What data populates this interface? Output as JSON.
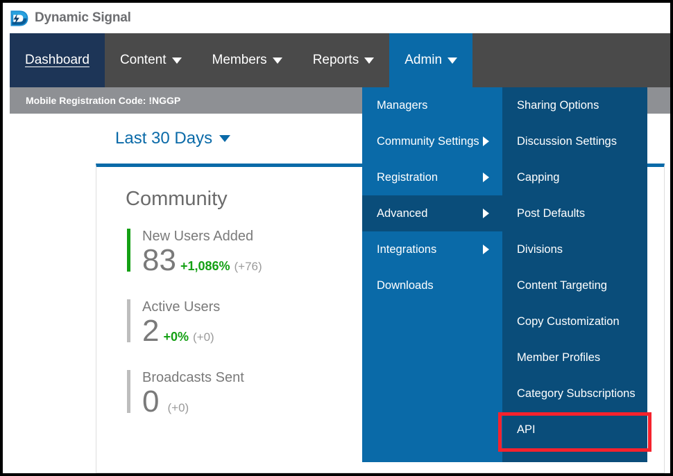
{
  "brand": {
    "name": "Dynamic Signal",
    "logo_icon": "dynamic-signal-d-bolt-logo",
    "accent_blue": "#0a6aa8",
    "dark_navy": "#1d3557",
    "submenu_navy": "#0a4d7a",
    "nav_gray": "#4a4a4a",
    "annotation_red": "#f5222d"
  },
  "nav": {
    "items": [
      {
        "label": "Dashboard",
        "has_caret": false,
        "state": "active"
      },
      {
        "label": "Content",
        "has_caret": true,
        "state": "default"
      },
      {
        "label": "Members",
        "has_caret": true,
        "state": "default"
      },
      {
        "label": "Reports",
        "has_caret": true,
        "state": "default"
      },
      {
        "label": "Admin",
        "has_caret": true,
        "state": "open"
      }
    ]
  },
  "registration_bar": {
    "text": "Mobile Registration Code: !NGGP"
  },
  "page": {
    "date_range": "Last 30 Days",
    "card": {
      "title": "Community",
      "stats": [
        {
          "label": "New Users Added",
          "value": "83",
          "delta_pct": "+1,086%",
          "delta_abs": "(+76)",
          "accent": "green"
        },
        {
          "label": "Active Users",
          "value": "2",
          "delta_pct": "+0%",
          "delta_abs": "(+0)",
          "accent": "gray"
        },
        {
          "label": "Broadcasts Sent",
          "value": "0",
          "delta_pct": "",
          "delta_abs": "(+0)",
          "accent": "gray"
        }
      ]
    }
  },
  "admin_menu": {
    "level1": [
      {
        "label": "Managers",
        "has_submenu": false,
        "selected": false
      },
      {
        "label": "Community Settings",
        "has_submenu": true,
        "selected": false
      },
      {
        "label": "Registration",
        "has_submenu": true,
        "selected": false
      },
      {
        "label": "Advanced",
        "has_submenu": true,
        "selected": true
      },
      {
        "label": "Integrations",
        "has_submenu": true,
        "selected": false
      },
      {
        "label": "Downloads",
        "has_submenu": false,
        "selected": false
      }
    ],
    "level2": [
      {
        "label": "Sharing Options",
        "highlighted": false
      },
      {
        "label": "Discussion Settings",
        "highlighted": false
      },
      {
        "label": "Capping",
        "highlighted": false
      },
      {
        "label": "Post Defaults",
        "highlighted": false
      },
      {
        "label": "Divisions",
        "highlighted": false
      },
      {
        "label": "Content Targeting",
        "highlighted": false
      },
      {
        "label": "Copy Customization",
        "highlighted": false
      },
      {
        "label": "Member Profiles",
        "highlighted": false
      },
      {
        "label": "Category Subscriptions",
        "highlighted": false
      },
      {
        "label": "API",
        "highlighted": true
      }
    ]
  }
}
